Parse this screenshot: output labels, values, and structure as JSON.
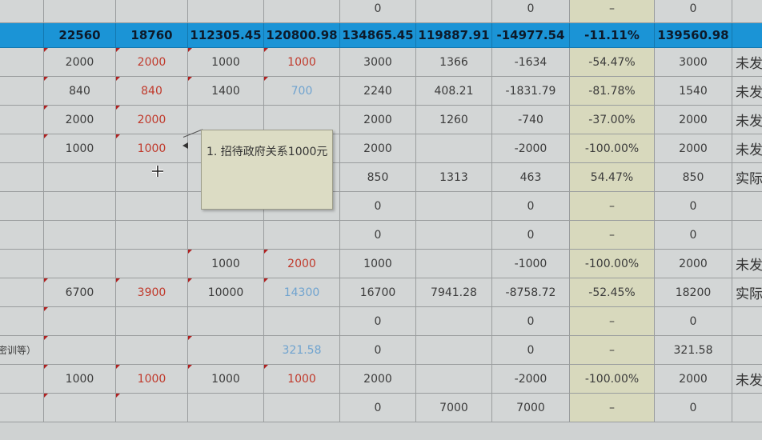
{
  "rows": [
    [
      "",
      "",
      "",
      "",
      "",
      "0",
      "",
      "0",
      "–",
      "0",
      ""
    ],
    [
      "",
      "22560",
      "18760",
      "112305.45",
      "120800.98",
      "134865.45",
      "119887.91",
      "-14977.54",
      "-11.11%",
      "139560.98",
      ""
    ],
    [
      "",
      "2000",
      "2000",
      "1000",
      "1000",
      "3000",
      "1366",
      "-1634",
      "-54.47%",
      "3000",
      "未发"
    ],
    [
      "",
      "840",
      "840",
      "1400",
      "700",
      "2240",
      "408.21",
      "-1831.79",
      "-81.78%",
      "1540",
      "未发"
    ],
    [
      "",
      "2000",
      "2000",
      "",
      "",
      "2000",
      "1260",
      "-740",
      "-37.00%",
      "2000",
      "未发"
    ],
    [
      "",
      "1000",
      "1000",
      "",
      "",
      "2000",
      "",
      "-2000",
      "-100.00%",
      "2000",
      "未发"
    ],
    [
      "",
      "",
      "",
      "",
      "",
      "850",
      "1313",
      "463",
      "54.47%",
      "850",
      "实际"
    ],
    [
      "",
      "",
      "",
      "",
      "",
      "0",
      "",
      "0",
      "–",
      "0",
      ""
    ],
    [
      "",
      "",
      "",
      "",
      "",
      "0",
      "",
      "0",
      "–",
      "0",
      ""
    ],
    [
      "",
      "",
      "",
      "1000",
      "2000",
      "1000",
      "",
      "-1000",
      "-100.00%",
      "2000",
      "未发"
    ],
    [
      "",
      "6700",
      "3900",
      "10000",
      "14300",
      "16700",
      "7941.28",
      "-8758.72",
      "-52.45%",
      "18200",
      "实际"
    ],
    [
      "",
      "",
      "",
      "",
      "",
      "0",
      "",
      "0",
      "–",
      "0",
      ""
    ],
    [
      "密训等）",
      "",
      "",
      "",
      "321.58",
      "0",
      "",
      "0",
      "–",
      "321.58",
      ""
    ],
    [
      "",
      "1000",
      "1000",
      "1000",
      "1000",
      "2000",
      "",
      "-2000",
      "-100.00%",
      "2000",
      "未发生"
    ],
    [
      "",
      "",
      "",
      "",
      "",
      "0",
      "7000",
      "7000",
      "–",
      "0",
      ""
    ]
  ],
  "comment": {
    "text": "1. 招待政府关系1000元"
  },
  "colors": {
    "total_row": "#1b94d6",
    "highlight_column": "#d8d9bd",
    "red_text": "#c0392b",
    "blue_text": "#6fa3cf"
  },
  "icons": {
    "cursor": "move-cursor-icon"
  }
}
